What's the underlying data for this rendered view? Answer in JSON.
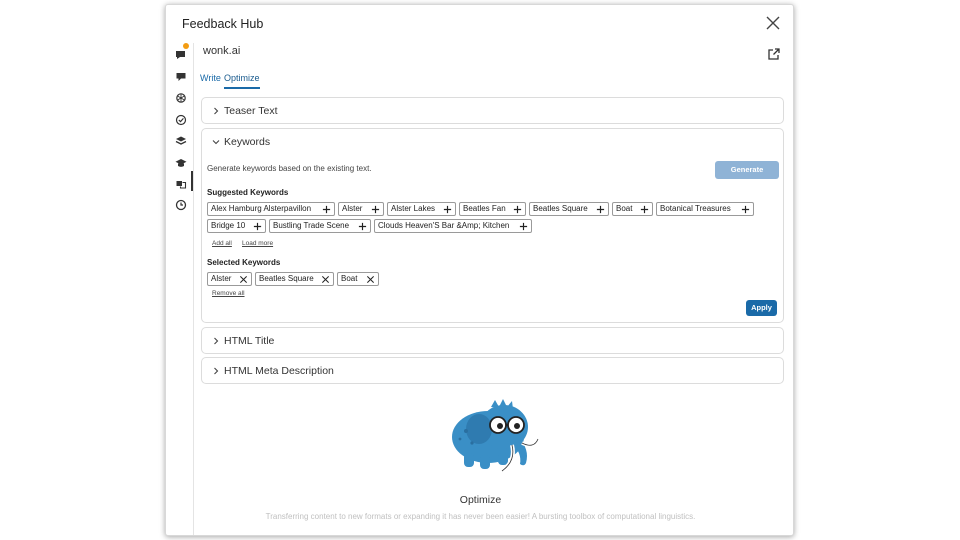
{
  "header": {
    "title": "Feedback Hub"
  },
  "brand": {
    "name": "wonk.ai"
  },
  "tabs": [
    {
      "label": "Write",
      "active": false
    },
    {
      "label": "Optimize",
      "active": true
    }
  ],
  "sidebar": {
    "icons": [
      "feedback-icon",
      "chat-icon",
      "openai-icon",
      "check-icon",
      "layers-icon",
      "graduation-cap-icon",
      "translate-icon",
      "history-icon"
    ],
    "notification_color": "#f39c12"
  },
  "sections": {
    "teaser": {
      "label": "Teaser Text",
      "expanded": false
    },
    "keywords": {
      "label": "Keywords",
      "expanded": true,
      "description": "Generate keywords based on the existing text.",
      "generate_label": "Generate",
      "suggested_label": "Suggested Keywords",
      "suggested": [
        "Alex Hamburg Alsterpavillon",
        "Alster",
        "Alster Lakes",
        "Beatles Fan",
        "Beatles Square",
        "Boat",
        "Botanical Treasures",
        "Bridge 10",
        "Bustling Trade Scene",
        "Clouds Heaven'S Bar &Amp; Kitchen"
      ],
      "add_all_label": "Add all",
      "load_more_label": "Load more",
      "selected_label": "Selected Keywords",
      "selected": [
        "Alster",
        "Beatles Square",
        "Boat"
      ],
      "remove_all_label": "Remove all",
      "apply_label": "Apply"
    },
    "html_title": {
      "label": "HTML Title",
      "expanded": false
    },
    "meta_description": {
      "label": "HTML Meta Description",
      "expanded": false
    }
  },
  "footer": {
    "title": "Optimize",
    "description": "Transferring content to new formats or expanding it has never been easier! A bursting toolbox of computational linguistics."
  },
  "colors": {
    "accent": "#1a6aa8",
    "generate_disabled": "#8fb3d6",
    "mascot": "#3a8fc6"
  }
}
